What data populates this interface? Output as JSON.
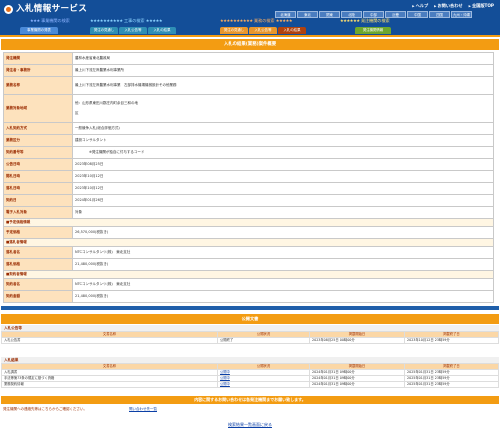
{
  "header": {
    "title": "入札情報サービス",
    "links": [
      "ヘルプ",
      "お問い合わせ",
      "全国版TOP"
    ],
    "regions": [
      "北海道",
      "東北",
      "関東",
      "北陸",
      "中部",
      "近畿",
      "中国",
      "四国",
      "九州・沖縄"
    ],
    "categories": [
      {
        "label": "事業機関の検索"
      },
      {
        "label": "工事の検索"
      },
      {
        "label": "業務の検索"
      },
      {
        "label": "発注機関の検索"
      }
    ],
    "tabs": [
      {
        "label": "事業機関の発表"
      },
      {
        "label": "発注の見通し"
      },
      {
        "label": "入札公告等"
      },
      {
        "label": "入札の結果"
      },
      {
        "label": "発注の見通し"
      },
      {
        "label": "入札公告等"
      },
      {
        "label": "入札の結果"
      },
      {
        "label": "発注機関情報"
      }
    ]
  },
  "section_title": "入札の結果(業務)案件概要",
  "rows": [
    {
      "label": "発注機関",
      "value": "農林水産省東北農政局"
    },
    {
      "label": "発注者・事務所",
      "value": "最上川下流左岸農業水利事業所"
    },
    {
      "label": "業務名称",
      "value": "最上川下流左岸農業水利事業　左部排水機場機械設計その他業務"
    },
    {
      "label": "業務対象地域",
      "value": "他：山形県東田川郡庄内町余目三和の地",
      "value2": "区"
    },
    {
      "label": "入札契約方式",
      "value": "一般競争入札(総合評価方式)"
    },
    {
      "label": "業務区分",
      "value": "建設コンサルタント"
    },
    {
      "label": "契約番号等",
      "value": "　　　　※発注機関が独自に付与するコード"
    },
    {
      "label": "公告日時",
      "value": "2023年08月25日"
    },
    {
      "label": "開札日時",
      "value": "2023年10月12日"
    },
    {
      "label": "落札日時",
      "value": "2023年10月12日"
    },
    {
      "label": "契約日",
      "value": "2024年01月26日"
    },
    {
      "label": "電子入札対象",
      "value": "対象"
    }
  ],
  "yotei_head": "■予定価格情報",
  "yotei": {
    "label": "予定価格",
    "value": "26,570,000(税抜き)"
  },
  "rakusatsu_head": "■落札者情報",
  "rakusatsu": [
    {
      "label": "落札者名",
      "value": "NTCコンサルタンツ(株)　東北支社"
    },
    {
      "label": "落札価格",
      "value": "21,480,000(税抜き)"
    }
  ],
  "keiyaku_head": "■契約者情報",
  "keiyaku": [
    {
      "label": "契約者名",
      "value": "NTCコンサルタンツ(株)　東北支社"
    },
    {
      "label": "契約金額",
      "value": "21,480,000(税抜き)"
    }
  ],
  "docs": {
    "title": "公開文書",
    "groups": [
      {
        "name": "入札公告等",
        "headers": [
          "文書名称",
          "公開状況",
          "掲載開始日",
          "掲載終了日"
        ],
        "rows": [
          [
            "入札公告書",
            "公開終了",
            "2023年08月25日 00時00分",
            "2023年10月12日 23時59分"
          ]
        ]
      },
      {
        "name": "入札結果",
        "headers": [
          "文書名称",
          "公開状況",
          "掲載開始日",
          "掲載終了日"
        ],
        "rows": [
          [
            "入札調書",
            "公開中",
            "2024年01月31日 09時00分",
            "2025年01月31日 23時59分"
          ],
          [
            "手法等第73条の規定に基づく資格",
            "公開中",
            "2024年01月31日 09時00分",
            "2025年01月31日 23時59分"
          ],
          [
            "業務契約情報",
            "公開中",
            "2024年01月31日 09時00分",
            "2025年01月31日 23時59分"
          ]
        ]
      }
    ]
  },
  "inquiry": {
    "title": "内容に関するお問い合わせは各発注機関までお願い致します。",
    "text": "発注機関への連絡先等はこちらからご確認ください。",
    "link": "問い合わせ先一覧"
  },
  "back": "検索結果一覧画面に戻る"
}
